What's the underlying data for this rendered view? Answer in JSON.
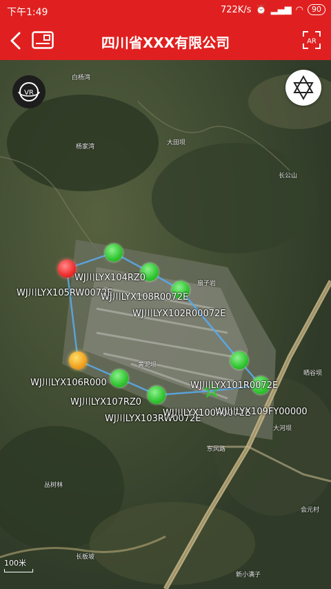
{
  "status_bar": {
    "time": "下午1:49",
    "network_speed": "722K/s",
    "battery": "90"
  },
  "app_bar": {
    "title": "四川省XXX有限公司",
    "ar_label": "AR"
  },
  "map": {
    "vr_label": "VR",
    "scale_label": "100米",
    "place_names": [
      "白杨湾",
      "杨家湾",
      "大田坝",
      "长公山",
      "扇子岩",
      "晒谷坝",
      "大河坝",
      "丛树林",
      "长板坡",
      "会元村",
      "新小满子",
      "东风路",
      "黄泥坝"
    ],
    "devices": [
      {
        "label": "WJ川LYX105RW0072E",
        "status": "red"
      },
      {
        "label": "WJ川LYX104RZ0",
        "status": "green"
      },
      {
        "label": "WJ川LYX108R0072E",
        "status": "green"
      },
      {
        "label": "WJ川LYX102R00072E",
        "status": "green"
      },
      {
        "label": "WJ川LYX106R000",
        "status": "orange"
      },
      {
        "label": "WJ川LYX107RZ0",
        "status": "green"
      },
      {
        "label": "WJ川LYX103RW0072E",
        "status": "green"
      },
      {
        "label": "WJ川LYX101R0072E",
        "status": "green"
      },
      {
        "label": "WJ川LYX100R0072E",
        "status": "green"
      },
      {
        "label": "WJ川LYX109FY00000",
        "status": "green"
      }
    ],
    "colors": {
      "green": "#2fc42f",
      "red": "#f02c2c",
      "orange": "#f0a020",
      "route": "#5aa8e8"
    }
  }
}
